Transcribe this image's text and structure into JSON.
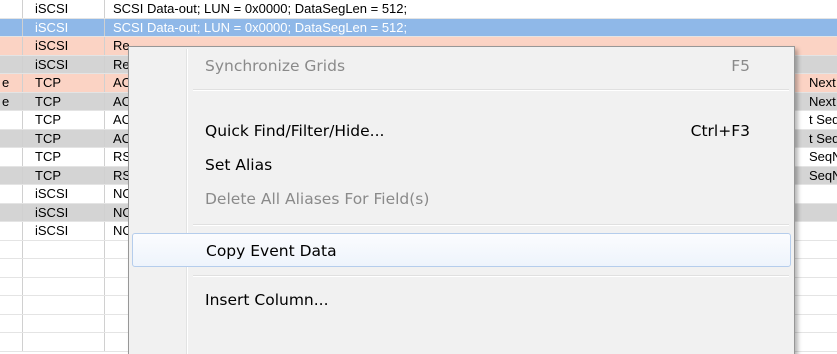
{
  "grid": {
    "rows": [
      {
        "bg": "bg-white",
        "c0": "",
        "protocol": "iSCSI",
        "summary": "SCSI Data-out; LUN = 0x0000; DataSegLen = 512;",
        "tail": ""
      },
      {
        "bg": "bg-sel",
        "c0": "",
        "protocol": "iSCSI",
        "summary": "SCSI Data-out; LUN = 0x0000; DataSegLen = 512;",
        "tail": ""
      },
      {
        "bg": "bg-salmon",
        "c0": "",
        "protocol": "iSCSI",
        "summary": "Re",
        "tail": ""
      },
      {
        "bg": "bg-gray",
        "c0": "",
        "protocol": "iSCSI",
        "summary": "Re",
        "tail": ""
      },
      {
        "bg": "bg-salmon",
        "c0": "e",
        "protocol": "TCP",
        "summary": "AC",
        "tail": "Next"
      },
      {
        "bg": "bg-gray",
        "c0": "e",
        "protocol": "TCP",
        "summary": "AC",
        "tail": "Next"
      },
      {
        "bg": "bg-white",
        "c0": "",
        "protocol": "TCP",
        "summary": "AC",
        "tail": "t Seq"
      },
      {
        "bg": "bg-gray",
        "c0": "",
        "protocol": "TCP",
        "summary": "AC",
        "tail": "t Seq"
      },
      {
        "bg": "bg-white",
        "c0": "",
        "protocol": "TCP",
        "summary": "RS",
        "tail": "SeqN"
      },
      {
        "bg": "bg-gray",
        "c0": "",
        "protocol": "TCP",
        "summary": "RS",
        "tail": "SeqN"
      },
      {
        "bg": "bg-white",
        "c0": "",
        "protocol": "iSCSI",
        "summary": "NO",
        "tail": ""
      },
      {
        "bg": "bg-gray",
        "c0": "",
        "protocol": "iSCSI",
        "summary": "NO",
        "tail": ""
      },
      {
        "bg": "bg-white",
        "c0": "",
        "protocol": "iSCSI",
        "summary": "NO",
        "tail": ""
      },
      {
        "bg": "bg-white",
        "c0": "",
        "protocol": "",
        "summary": "",
        "tail": ""
      },
      {
        "bg": "bg-white",
        "c0": "",
        "protocol": "",
        "summary": "",
        "tail": ""
      },
      {
        "bg": "bg-white",
        "c0": "",
        "protocol": "",
        "summary": "",
        "tail": ""
      },
      {
        "bg": "bg-white",
        "c0": "",
        "protocol": "",
        "summary": "",
        "tail": ""
      },
      {
        "bg": "bg-white",
        "c0": "",
        "protocol": "",
        "summary": "",
        "tail": ""
      },
      {
        "bg": "bg-white",
        "c0": "",
        "protocol": "",
        "summary": "",
        "tail": ""
      }
    ]
  },
  "menu": {
    "items": [
      {
        "type": "item",
        "label": "Synchronize Grids",
        "shortcut": "F5",
        "disabled": true,
        "hovered": false
      },
      {
        "type": "separator"
      },
      {
        "type": "item",
        "label": "Quick Find/Filter/Hide...",
        "shortcut": "Ctrl+F3",
        "disabled": false,
        "hovered": false
      },
      {
        "type": "item",
        "label": "Set Alias",
        "shortcut": "",
        "disabled": false,
        "hovered": false
      },
      {
        "type": "item",
        "label": "Delete All Aliases For Field(s)",
        "shortcut": "",
        "disabled": true,
        "hovered": false
      },
      {
        "type": "separator"
      },
      {
        "type": "item",
        "label": "Copy Event Data",
        "shortcut": "",
        "disabled": false,
        "hovered": true
      },
      {
        "type": "separator"
      },
      {
        "type": "item",
        "label": "Insert Column...",
        "shortcut": "",
        "disabled": false,
        "hovered": false
      }
    ]
  }
}
